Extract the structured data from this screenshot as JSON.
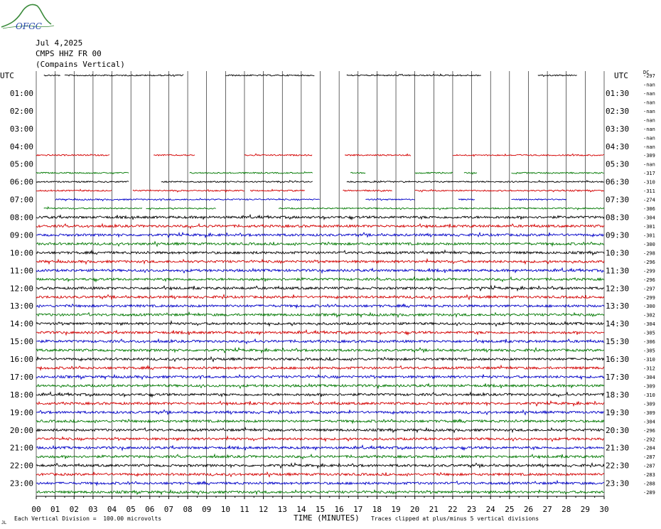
{
  "header": {
    "logo_text": "OFGC",
    "date": "Jul 4,2025",
    "station": "CMPS HHZ FR 00",
    "location": "(Compains Vertical)"
  },
  "footer": {
    "marker": "JL",
    "division": "Each Vertical Division =  100.00 microvolts",
    "clip_note": "Traces clipped at plus/minus 5 vertical divisions"
  },
  "colors": {
    "black": "#000000",
    "red": "#d40000",
    "blue": "#0000c8",
    "green": "#007800"
  },
  "chart_data": {
    "type": "line",
    "title": "",
    "xlabel": "TIME (MINUTES)",
    "left_axis_label": "UTC",
    "right_axis_label": "UTC",
    "dc_label": "DC",
    "xlim": [
      0,
      30
    ],
    "x_ticks": [
      "00",
      "01",
      "02",
      "03",
      "04",
      "05",
      "06",
      "07",
      "08",
      "09",
      "10",
      "11",
      "12",
      "13",
      "14",
      "15",
      "16",
      "17",
      "18",
      "19",
      "20",
      "21",
      "22",
      "23",
      "24",
      "25",
      "26",
      "27",
      "28",
      "29",
      "30"
    ],
    "left_hours": [
      "01:00",
      "02:00",
      "03:00",
      "04:00",
      "05:00",
      "06:00",
      "07:00",
      "08:00",
      "09:00",
      "10:00",
      "11:00",
      "12:00",
      "13:00",
      "14:00",
      "15:00",
      "16:00",
      "17:00",
      "18:00",
      "19:00",
      "20:00",
      "21:00",
      "22:00",
      "23:00"
    ],
    "right_hours": [
      "01:30",
      "02:30",
      "03:30",
      "04:30",
      "05:30",
      "06:30",
      "07:30",
      "08:30",
      "09:30",
      "10:30",
      "11:30",
      "12:30",
      "13:30",
      "14:30",
      "15:30",
      "16:30",
      "17:30",
      "18:30",
      "19:30",
      "20:30",
      "21:30",
      "22:30",
      "23:30"
    ],
    "trace_colors_cycle": [
      "black",
      "red",
      "blue",
      "green"
    ],
    "dc_offsets": [
      "-297",
      "-nan",
      "-nan",
      "-nan",
      "-nan",
      "-nan",
      "-nan",
      "-nan",
      "-nan",
      "-309",
      "-nan",
      "-317",
      "-310",
      "-311",
      "-274",
      "-306",
      "-304",
      "-301",
      "-301",
      "-300",
      "-298",
      "-296",
      "-299",
      "-296",
      "-297",
      "-299",
      "-300",
      "-302",
      "-304",
      "-305",
      "-306",
      "-305",
      "-310",
      "-312",
      "-304",
      "-309",
      "-310",
      "-309",
      "-309",
      "-304",
      "-296",
      "-292",
      "-284",
      "-287",
      "-287",
      "-283",
      "-288",
      "-289"
    ],
    "traces": [
      {
        "row": 0,
        "color": "black",
        "segments": [
          [
            0.4,
            1.3
          ],
          [
            1.5,
            7.8
          ],
          [
            10,
            14.7
          ],
          [
            16.4,
            23.5
          ],
          [
            26.5,
            28.6
          ]
        ]
      },
      {
        "row": 1,
        "color": "red",
        "segments": []
      },
      {
        "row": 2,
        "color": "blue",
        "segments": []
      },
      {
        "row": 3,
        "color": "green",
        "segments": []
      },
      {
        "row": 4,
        "color": "black",
        "segments": []
      },
      {
        "row": 5,
        "color": "red",
        "segments": []
      },
      {
        "row": 6,
        "color": "blue",
        "segments": []
      },
      {
        "row": 7,
        "color": "green",
        "segments": []
      },
      {
        "row": 8,
        "color": "black",
        "segments": []
      },
      {
        "row": 9,
        "color": "red",
        "segments": [
          [
            0,
            3.9
          ],
          [
            6.2,
            8.4
          ],
          [
            11,
            14.6
          ],
          [
            16.3,
            19.8
          ],
          [
            22,
            30
          ]
        ]
      },
      {
        "row": 10,
        "color": "blue",
        "segments": []
      },
      {
        "row": 11,
        "color": "green",
        "segments": [
          [
            0,
            4.9
          ],
          [
            8.1,
            14.6
          ],
          [
            16.6,
            17.4
          ],
          [
            20,
            22
          ],
          [
            22.6,
            23.3
          ],
          [
            25.1,
            30
          ]
        ]
      },
      {
        "row": 12,
        "color": "black",
        "segments": [
          [
            0,
            4.9
          ],
          [
            6.6,
            14.6
          ],
          [
            16.4,
            30
          ]
        ]
      },
      {
        "row": 13,
        "color": "red",
        "segments": [
          [
            0,
            4
          ],
          [
            5.1,
            11
          ],
          [
            11.3,
            14.2
          ],
          [
            16.2,
            18.8
          ],
          [
            20,
            30
          ]
        ]
      },
      {
        "row": 14,
        "color": "blue",
        "segments": [
          [
            1,
            15
          ],
          [
            17.4,
            20
          ],
          [
            22.3,
            23.2
          ],
          [
            25.1,
            28
          ]
        ]
      },
      {
        "row": 15,
        "color": "green",
        "segments": [
          [
            0.4,
            5.6
          ],
          [
            5.8,
            9.5
          ],
          [
            12.8,
            30
          ]
        ]
      },
      {
        "row": 16,
        "color": "black",
        "segments": [
          [
            0,
            30
          ]
        ]
      },
      {
        "row": 17,
        "color": "red",
        "segments": [
          [
            0,
            30
          ]
        ]
      },
      {
        "row": 18,
        "color": "blue",
        "segments": [
          [
            0,
            30
          ]
        ]
      },
      {
        "row": 19,
        "color": "green",
        "segments": [
          [
            0,
            30
          ]
        ]
      },
      {
        "row": 20,
        "color": "black",
        "segments": [
          [
            0,
            30
          ]
        ]
      },
      {
        "row": 21,
        "color": "red",
        "segments": [
          [
            0,
            30
          ]
        ]
      },
      {
        "row": 22,
        "color": "blue",
        "segments": [
          [
            0,
            30
          ]
        ]
      },
      {
        "row": 23,
        "color": "green",
        "segments": [
          [
            0,
            30
          ]
        ]
      },
      {
        "row": 24,
        "color": "black",
        "segments": [
          [
            0,
            30
          ]
        ]
      },
      {
        "row": 25,
        "color": "red",
        "segments": [
          [
            0,
            30
          ]
        ]
      },
      {
        "row": 26,
        "color": "blue",
        "segments": [
          [
            0,
            30
          ]
        ]
      },
      {
        "row": 27,
        "color": "green",
        "segments": [
          [
            0,
            30
          ]
        ]
      },
      {
        "row": 28,
        "color": "black",
        "segments": [
          [
            0,
            30
          ]
        ]
      },
      {
        "row": 29,
        "color": "red",
        "segments": [
          [
            0,
            30
          ]
        ]
      },
      {
        "row": 30,
        "color": "blue",
        "segments": [
          [
            0,
            30
          ]
        ]
      },
      {
        "row": 31,
        "color": "green",
        "segments": [
          [
            0,
            30
          ]
        ]
      },
      {
        "row": 32,
        "color": "black",
        "segments": [
          [
            0,
            30
          ]
        ]
      },
      {
        "row": 33,
        "color": "red",
        "segments": [
          [
            0,
            30
          ]
        ]
      },
      {
        "row": 34,
        "color": "blue",
        "segments": [
          [
            0,
            30
          ]
        ]
      },
      {
        "row": 35,
        "color": "green",
        "segments": [
          [
            0,
            30
          ]
        ]
      },
      {
        "row": 36,
        "color": "black",
        "segments": [
          [
            0,
            30
          ]
        ]
      },
      {
        "row": 37,
        "color": "red",
        "segments": [
          [
            0,
            30
          ]
        ]
      },
      {
        "row": 38,
        "color": "blue",
        "segments": [
          [
            0,
            30
          ]
        ]
      },
      {
        "row": 39,
        "color": "green",
        "segments": [
          [
            0,
            30
          ]
        ]
      },
      {
        "row": 40,
        "color": "black",
        "segments": [
          [
            0,
            30
          ]
        ]
      },
      {
        "row": 41,
        "color": "red",
        "segments": [
          [
            0,
            30
          ]
        ]
      },
      {
        "row": 42,
        "color": "blue",
        "segments": [
          [
            0,
            30
          ]
        ]
      },
      {
        "row": 43,
        "color": "green",
        "segments": [
          [
            0,
            30
          ]
        ]
      },
      {
        "row": 44,
        "color": "black",
        "segments": [
          [
            0,
            30
          ]
        ]
      },
      {
        "row": 45,
        "color": "red",
        "segments": [
          [
            0,
            30
          ]
        ]
      },
      {
        "row": 46,
        "color": "blue",
        "segments": [
          [
            0,
            30
          ]
        ]
      },
      {
        "row": 47,
        "color": "green",
        "segments": [
          [
            0,
            30
          ]
        ]
      }
    ]
  }
}
